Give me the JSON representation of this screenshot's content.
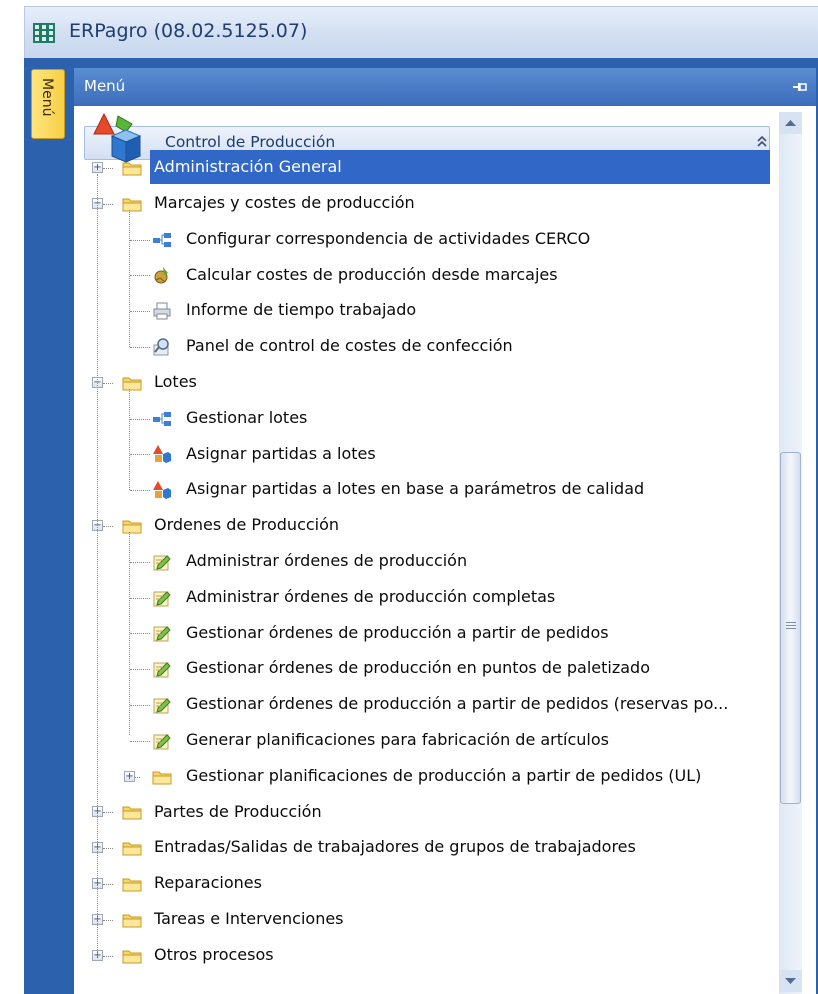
{
  "window": {
    "title": "ERPagro (08.02.5125.07)",
    "side_tab": "Menú",
    "menu_header": "Menú"
  },
  "group": {
    "title": "Control de Producción"
  },
  "tree": [
    {
      "label": "Administración General",
      "type": "folder",
      "level": 0,
      "expanded": false,
      "selected": true
    },
    {
      "label": "Marcajes y costes de producción",
      "type": "folder",
      "level": 0,
      "expanded": true
    },
    {
      "label": "Configurar correspondencia de actividades CERCO",
      "type": "item",
      "icon": "flow-icon",
      "level": 1
    },
    {
      "label": "Calcular costes de producción desde marcajes",
      "type": "item",
      "icon": "calculator-icon",
      "level": 1
    },
    {
      "label": "Informe de tiempo trabajado",
      "type": "item",
      "icon": "printer-icon",
      "level": 1
    },
    {
      "label": "Panel de control de costes de confección",
      "type": "item",
      "icon": "magnifier-icon",
      "level": 1
    },
    {
      "label": "Lotes",
      "type": "folder",
      "level": 0,
      "expanded": true
    },
    {
      "label": "Gestionar lotes",
      "type": "item",
      "icon": "flow-icon",
      "level": 1
    },
    {
      "label": "Asignar partidas a lotes",
      "type": "item",
      "icon": "shapes-icon",
      "level": 1
    },
    {
      "label": "Asignar partidas a lotes en base a parámetros de calidad",
      "type": "item",
      "icon": "shapes-icon",
      "level": 1
    },
    {
      "label": "Ordenes de Producción",
      "type": "folder",
      "level": 0,
      "expanded": true
    },
    {
      "label": "Administrar órdenes de producción",
      "type": "item",
      "icon": "edit-icon",
      "level": 1
    },
    {
      "label": "Administrar órdenes de producción completas",
      "type": "item",
      "icon": "edit-icon",
      "level": 1
    },
    {
      "label": "Gestionar órdenes de producción a partir de pedidos",
      "type": "item",
      "icon": "edit-icon",
      "level": 1
    },
    {
      "label": "Gestionar órdenes de producción en puntos de paletizado",
      "type": "item",
      "icon": "edit-icon",
      "level": 1
    },
    {
      "label": "Gestionar órdenes de producción a partir de pedidos (reservas po...",
      "type": "item",
      "icon": "edit-icon",
      "level": 1
    },
    {
      "label": "Generar planificaciones para fabricación de artículos",
      "type": "item",
      "icon": "edit-icon",
      "level": 1
    },
    {
      "label": "Gestionar planificaciones de producción a partir de pedidos (UL)",
      "type": "folder",
      "level": 1,
      "expanded": false
    },
    {
      "label": "Partes de Producción",
      "type": "folder",
      "level": 0,
      "expanded": false
    },
    {
      "label": "Entradas/Salidas de trabajadores de grupos de trabajadores",
      "type": "folder",
      "level": 0,
      "expanded": false
    },
    {
      "label": "Reparaciones",
      "type": "folder",
      "level": 0,
      "expanded": false
    },
    {
      "label": "Tareas e Intervenciones",
      "type": "folder",
      "level": 0,
      "expanded": false
    },
    {
      "label": "Otros procesos",
      "type": "folder",
      "level": 0,
      "expanded": false
    }
  ],
  "colors": {
    "frame_blue": "#2c61ad",
    "selection": "#3168c7",
    "tab_yellow": "#f8cf45"
  }
}
